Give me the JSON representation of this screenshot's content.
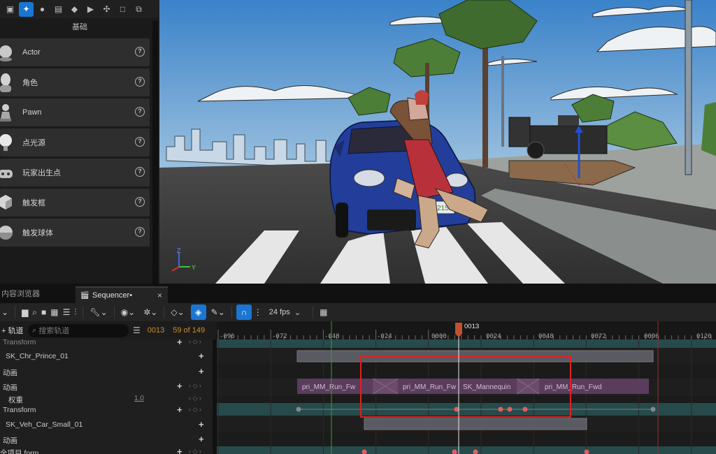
{
  "left_panel": {
    "section_title": "基础",
    "mode_icons": [
      "select-icon",
      "place-actors-icon",
      "light-icon",
      "landscape-icon",
      "shield-icon",
      "media-icon",
      "geometry-icon",
      "volume-icon",
      "copy-icon"
    ],
    "items": [
      {
        "label": "Actor",
        "icon": "actor-sphere-icon"
      },
      {
        "label": "角色",
        "icon": "character-icon"
      },
      {
        "label": "Pawn",
        "icon": "pawn-icon"
      },
      {
        "label": "点光源",
        "icon": "point-light-icon"
      },
      {
        "label": "玩家出生点",
        "icon": "player-start-icon"
      },
      {
        "label": "触发框",
        "icon": "trigger-box-icon"
      },
      {
        "label": "触发球体",
        "icon": "trigger-sphere-icon"
      }
    ]
  },
  "viewport": {
    "plate_text": "1D 5215J",
    "axis_z": "Z",
    "axis_y": "Y"
  },
  "tabs": {
    "content_browser": "内容浏览器",
    "sequencer": "Sequencer•",
    "close": "×"
  },
  "toolbar": {
    "fps": "24 fps"
  },
  "filter_bar": {
    "add_track": "+ 轨道",
    "search_placeholder": "搜索轨道",
    "current_frame": "0013",
    "frame_count": "59 of 149"
  },
  "tracks": [
    {
      "label": "Transform",
      "indent": 4
    },
    {
      "label": "SK_Chr_Prince_01",
      "indent": 8
    },
    {
      "label": "动画",
      "indent": 4
    },
    {
      "label": "动画",
      "indent": 4
    },
    {
      "label": "权重",
      "indent": 12,
      "value": "1.0"
    },
    {
      "label": "Transform",
      "indent": 4
    },
    {
      "label": "SK_Veh_Car_Small_01",
      "indent": 8
    },
    {
      "label": "动画",
      "indent": 4
    },
    {
      "label": "全项目 form",
      "indent": 0
    }
  ],
  "timeline": {
    "playhead_label": "0013",
    "ruler": [
      "-096",
      "-072",
      "-048",
      "-024",
      "0000",
      "0024",
      "0048",
      "0072",
      "0096",
      "0120"
    ],
    "clips": [
      "pri_MM_Run_Fw",
      "pri_MM_Run_Fw",
      "SK_Mannequin",
      "pri_MM_Run_Fwd"
    ]
  },
  "colors": {
    "accent_blue": "#1a76d2",
    "selection_red": "#e02020",
    "playhead": "#c0502f",
    "anim_clip": "#5a3c5c",
    "track_teal": "#2f4f4f"
  }
}
